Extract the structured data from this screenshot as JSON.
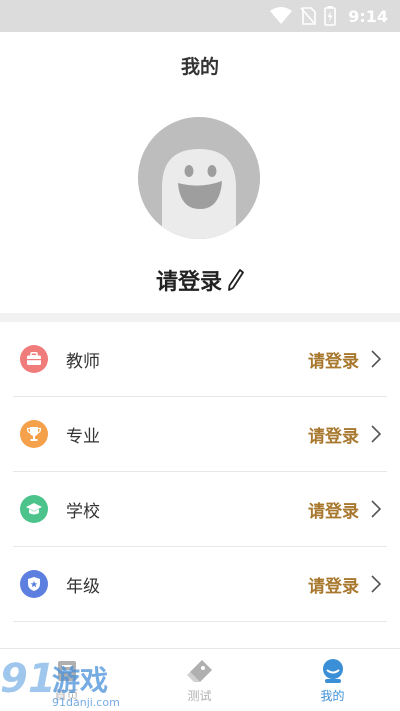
{
  "status_bar": {
    "time": "9:14",
    "icons": [
      "wifi-icon",
      "no-sim-icon",
      "battery-charging-icon"
    ]
  },
  "header": {
    "title": "我的"
  },
  "profile": {
    "avatar_icon": "ghost-avatar-icon",
    "login_label": "请登录",
    "edit_icon": "pencil-icon"
  },
  "info_list": [
    {
      "label": "教师",
      "value": "请登录",
      "icon": "briefcase-icon",
      "color": "#f07b7b"
    },
    {
      "label": "专业",
      "value": "请登录",
      "icon": "trophy-icon",
      "color": "#f5a04a"
    },
    {
      "label": "学校",
      "value": "请登录",
      "icon": "graduation-cap-icon",
      "color": "#4dc38c"
    },
    {
      "label": "年级",
      "value": "请登录",
      "icon": "badge-icon",
      "color": "#5d7fe0"
    }
  ],
  "tabs": [
    {
      "label": "首页",
      "icon": "home-icon",
      "active": false
    },
    {
      "label": "测试",
      "icon": "eraser-icon",
      "active": false
    },
    {
      "label": "我的",
      "icon": "profile-icon",
      "active": true
    }
  ],
  "colors": {
    "accent": "#3a8fd6",
    "value_text": "#a8782e",
    "tab_inactive": "#b0b0b0"
  },
  "watermark": {
    "brand": "91游戏",
    "url": "91danji.com"
  }
}
